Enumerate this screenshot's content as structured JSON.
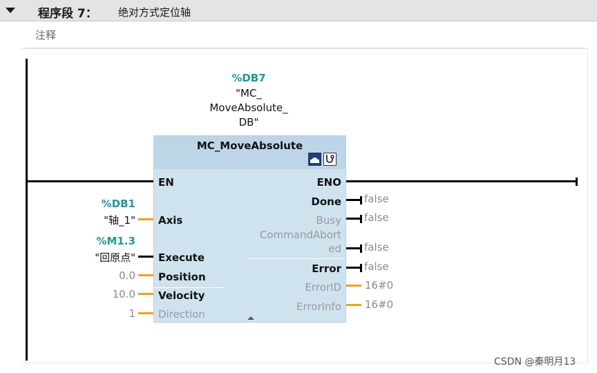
{
  "segment": {
    "title": "程序段 7：",
    "name": "绝对方式定位轴",
    "comment": "注释"
  },
  "instance": {
    "db_address": "%DB7",
    "db_name_lines": [
      "\"MC_",
      "MoveAbsolute_",
      "DB\""
    ]
  },
  "block": {
    "title": "MC_MoveAbsolute",
    "icons": [
      "axis-icon",
      "diagnostics-icon"
    ],
    "inputs": {
      "en": "EN",
      "axis": "Axis",
      "execute": "Execute",
      "position": "Position",
      "velocity": "Velocity",
      "direction": "Direction"
    },
    "outputs": {
      "eno": "ENO",
      "done": "Done",
      "busy": "Busy",
      "command_aborted_1": "CommandAbort",
      "command_aborted_2": "ed",
      "error": "Error",
      "error_id": "ErrorID",
      "error_info": "ErrorInfo"
    }
  },
  "operands": {
    "axis_addr": "%DB1",
    "axis_name": "\"轴_1\"",
    "execute_addr": "%M1.3",
    "execute_name": "\"回原点\"",
    "position": "0.0",
    "velocity": "10.0",
    "direction": "1"
  },
  "output_values": {
    "done": "false",
    "busy": "false",
    "command_aborted": "false",
    "error": "false",
    "error_id": "16#0",
    "error_info": "16#0"
  },
  "watermark": "CSDN @秦明月13",
  "colors": {
    "operand_address": "#1a9a9a",
    "block_fill": "#cfe3ef",
    "block_header": "#bdd6e7",
    "value_wire": "#f4a300",
    "bool_wire": "#000000"
  }
}
